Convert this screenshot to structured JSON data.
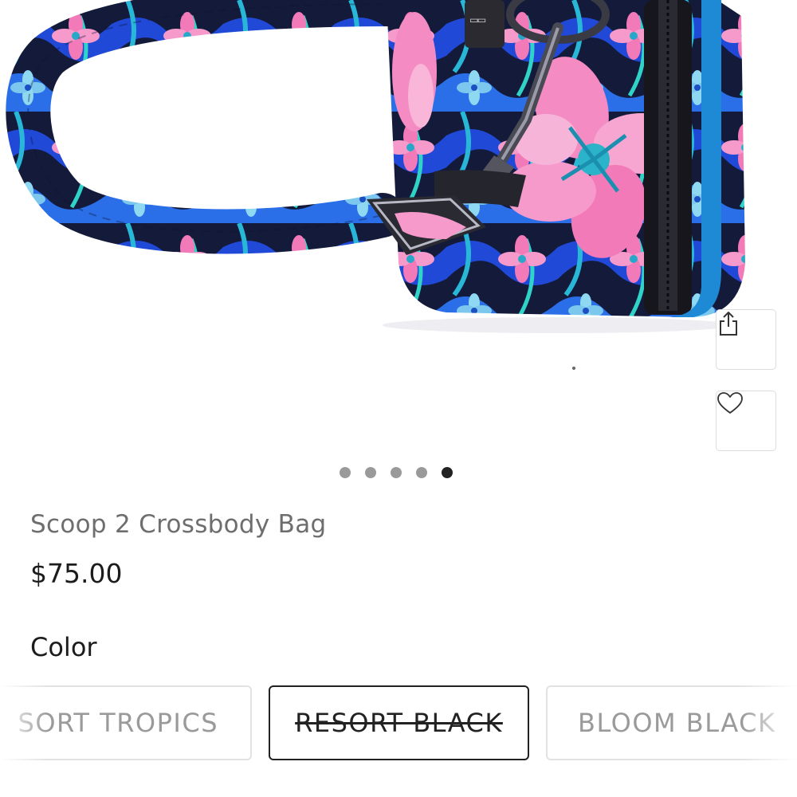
{
  "product": {
    "title": "Scoop 2 Crossbody Bag",
    "price": "$75.00"
  },
  "gallery": {
    "image_count": 5,
    "active_index": 4,
    "icons": {
      "share": "share-icon",
      "wishlist": "heart-icon"
    }
  },
  "color": {
    "label": "Color",
    "options": [
      {
        "label": "SORT TROPICS",
        "selected": false,
        "unavailable": false
      },
      {
        "label": "RESORT BLACK",
        "selected": true,
        "unavailable": true
      },
      {
        "label": "BLOOM BLACK",
        "selected": false,
        "unavailable": false
      }
    ]
  },
  "colors": {
    "text_primary": "#1c1c1c",
    "text_muted": "#6e6e6e",
    "dot_active": "#222222",
    "dot_inactive": "#9a9a9a",
    "border": "#dcdcdc"
  }
}
